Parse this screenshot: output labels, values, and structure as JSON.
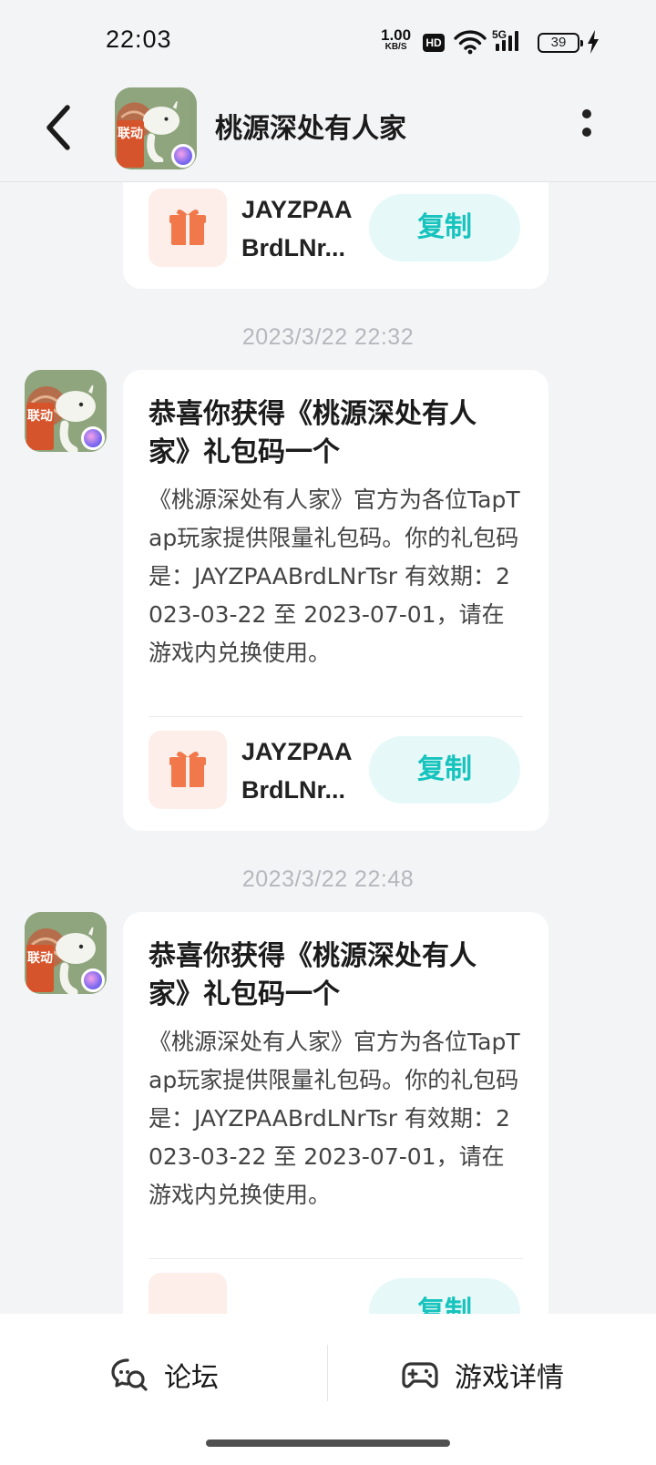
{
  "status_bar": {
    "time": "22:03",
    "speed_value": "1.00",
    "speed_unit": "KB/S",
    "hd": "HD",
    "network": "5G",
    "battery": "39"
  },
  "header": {
    "title": "桃源深处有人家",
    "avatar_tag": "联动"
  },
  "messages": [
    {
      "code_line1": "JAYZPAA",
      "code_line2": "BrdLNr...",
      "copy_label": "复制"
    },
    {
      "timestamp": "2023/3/22  22:32",
      "title": "恭喜你获得《桃源深处有人家》礼包码一个",
      "body": "《桃源深处有人家》官方为各位TapTap玩家提供限量礼包码。你的礼包码是：JAYZPAABrdLNrTsr 有效期：2023-03-22 至 2023-07-01，请在游戏内兑换使用。",
      "code_line1": "JAYZPAA",
      "code_line2": "BrdLNr...",
      "copy_label": "复制"
    },
    {
      "timestamp": "2023/3/22  22:48",
      "title": "恭喜你获得《桃源深处有人家》礼包码一个",
      "body": "《桃源深处有人家》官方为各位TapTap玩家提供限量礼包码。你的礼包码是：JAYZPAABrdLNrTsr 有效期：2023-03-22 至 2023-07-01，请在游戏内兑换使用。",
      "copy_label": "复制"
    }
  ],
  "bottom_bar": {
    "forum_label": "论坛",
    "details_label": "游戏详情"
  },
  "colors": {
    "accent": "#17c3bd",
    "copy_bg": "#e6f9f8",
    "gift": "#f0784a",
    "gift_bg": "#fdeeea"
  }
}
